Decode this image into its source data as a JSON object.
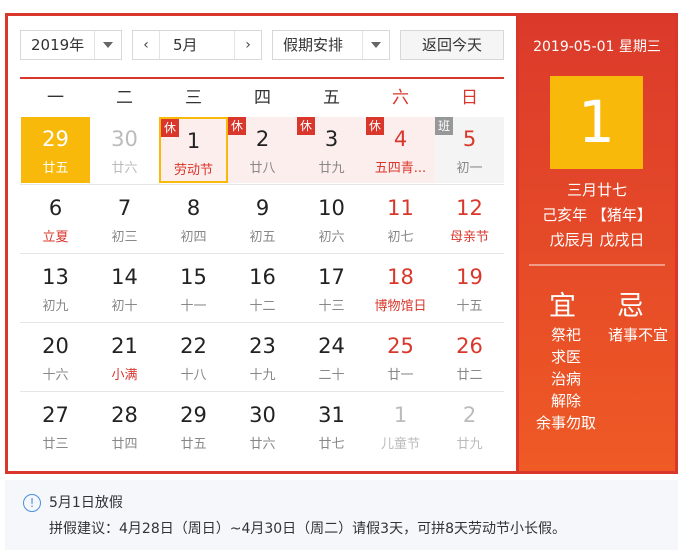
{
  "controls": {
    "year": "2019年",
    "month": "5月",
    "prev_symbol": "‹",
    "next_symbol": "›",
    "holiday_select": "假期安排",
    "today_button": "返回今天"
  },
  "weekdays": [
    "一",
    "二",
    "三",
    "四",
    "五",
    "六",
    "日"
  ],
  "days": [
    {
      "num": "29",
      "sub": "廿五",
      "today": true
    },
    {
      "num": "30",
      "sub": "廿六",
      "other": true
    },
    {
      "num": "1",
      "sub": "劳动节",
      "sub_red": true,
      "badge": "休",
      "holiday": true,
      "selected": true
    },
    {
      "num": "2",
      "sub": "廿八",
      "badge": "休",
      "holiday": true
    },
    {
      "num": "3",
      "sub": "廿九",
      "badge": "休",
      "holiday": true
    },
    {
      "num": "4",
      "sub": "五四青...",
      "sub_red": true,
      "badge": "休",
      "holiday": true
    },
    {
      "num": "5",
      "sub": "初一",
      "badge": "班",
      "workday": true
    },
    {
      "num": "6",
      "sub": "立夏",
      "sub_red": true
    },
    {
      "num": "7",
      "sub": "初三"
    },
    {
      "num": "8",
      "sub": "初四"
    },
    {
      "num": "9",
      "sub": "初五"
    },
    {
      "num": "10",
      "sub": "初六"
    },
    {
      "num": "11",
      "sub": "初七"
    },
    {
      "num": "12",
      "sub": "母亲节",
      "sub_red": true
    },
    {
      "num": "13",
      "sub": "初九"
    },
    {
      "num": "14",
      "sub": "初十"
    },
    {
      "num": "15",
      "sub": "十一"
    },
    {
      "num": "16",
      "sub": "十二"
    },
    {
      "num": "17",
      "sub": "十三"
    },
    {
      "num": "18",
      "sub": "博物馆日",
      "sub_red": true
    },
    {
      "num": "19",
      "sub": "十五"
    },
    {
      "num": "20",
      "sub": "十六"
    },
    {
      "num": "21",
      "sub": "小满",
      "sub_red": true
    },
    {
      "num": "22",
      "sub": "十八"
    },
    {
      "num": "23",
      "sub": "十九"
    },
    {
      "num": "24",
      "sub": "二十"
    },
    {
      "num": "25",
      "sub": "廿一"
    },
    {
      "num": "26",
      "sub": "廿二"
    },
    {
      "num": "27",
      "sub": "廿三"
    },
    {
      "num": "28",
      "sub": "廿四"
    },
    {
      "num": "29",
      "sub": "廿五"
    },
    {
      "num": "30",
      "sub": "廿六"
    },
    {
      "num": "31",
      "sub": "廿七"
    },
    {
      "num": "1",
      "sub": "儿童节",
      "other": true
    },
    {
      "num": "2",
      "sub": "廿九",
      "other": true
    }
  ],
  "detail": {
    "date_header": "2019-05-01 星期三",
    "big_day": "1",
    "lunar_date": "三月廿七",
    "ganzhi_year": "己亥年 【猪年】",
    "ganzhi_month_day": "戊辰月 戊戌日",
    "yi_title": "宜",
    "ji_title": "忌",
    "yi_items": [
      "祭祀",
      "求医",
      "治病",
      "解除",
      "余事勿取"
    ],
    "ji_items": [
      "诸事不宜"
    ]
  },
  "notice": {
    "icon": "info-icon",
    "icon_glyph": "!",
    "title": "5月1日放假",
    "text": "拼假建议：4月28日（周日）~4月30日（周二）请假3天，可拼8天劳动节小长假。"
  },
  "colors": {
    "accent_red": "#d9372b",
    "today_yellow": "#f9b90b",
    "holiday_bg": "#fdeeee",
    "workday_badge": "#969799"
  }
}
